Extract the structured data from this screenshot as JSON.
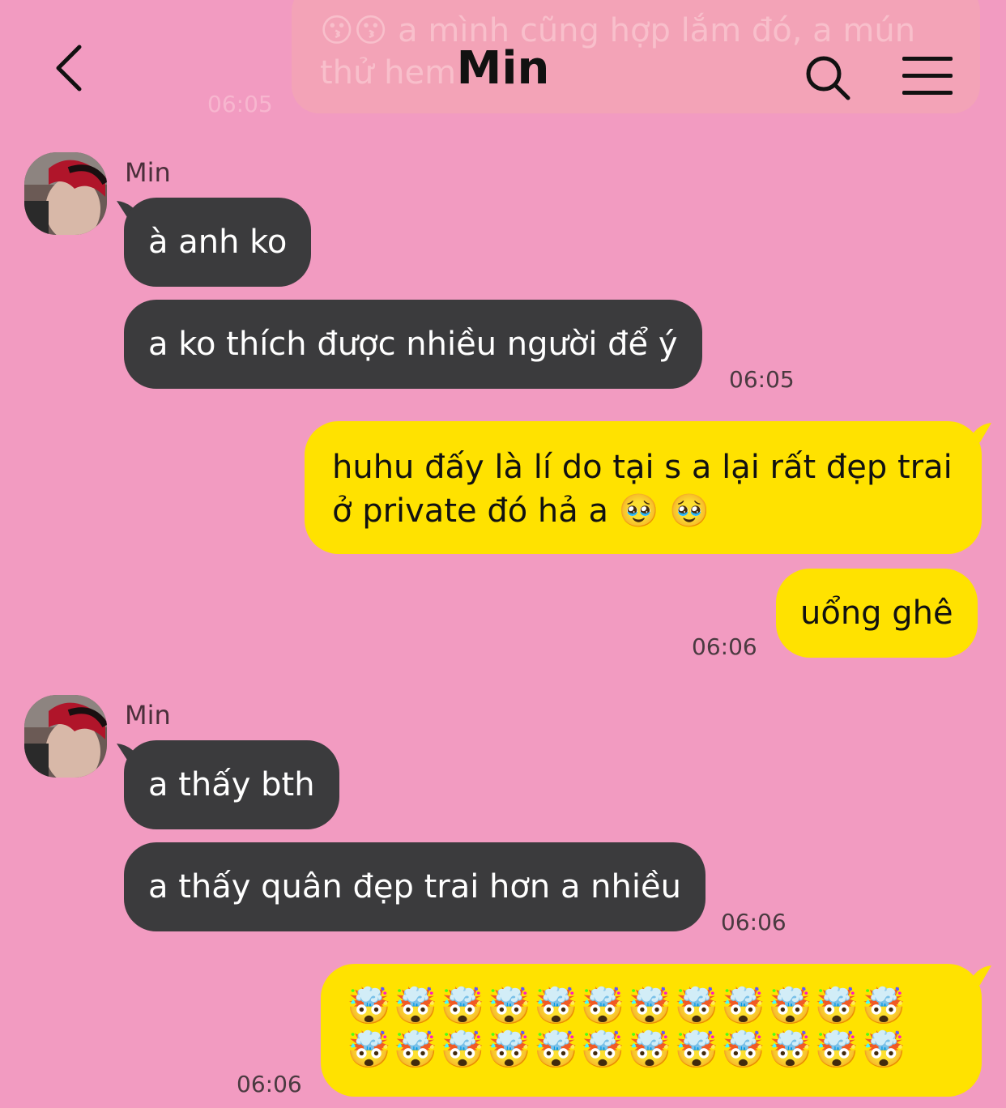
{
  "header": {
    "title": "Min"
  },
  "faded_message": {
    "text": "😗😗 a mình cũng hợp lắm đó, a mún thử hem",
    "time": "06:05"
  },
  "messages": [
    {
      "sender": "Min",
      "bubbles": [
        "à anh ko",
        "a ko thích được nhiều người để ý"
      ],
      "time": "06:05"
    },
    {
      "bubbles": [
        "huhu đấy là lí do tại s a lại rất đẹp trai",
        "ở private đó hả a 🥹 🥹",
        "uổng ghê"
      ],
      "time": "06:06"
    },
    {
      "sender": "Min",
      "bubbles": [
        "a thấy bth",
        "a thấy quân đẹp trai hơn a nhiều"
      ],
      "time": "06:06"
    },
    {
      "bubbles": [
        "🤯🤯🤯🤯🤯🤯🤯🤯🤯🤯🤯🤯",
        "🤯🤯🤯🤯🤯🤯🤯🤯🤯🤯🤯🤯"
      ],
      "time": "06:06"
    }
  ],
  "colors": {
    "background": "#f29bc1",
    "incoming": "#3b3b3d",
    "outgoing": "#ffe200"
  },
  "icons": {
    "back": "chevron-left-icon",
    "search": "search-icon",
    "menu": "menu-icon"
  }
}
